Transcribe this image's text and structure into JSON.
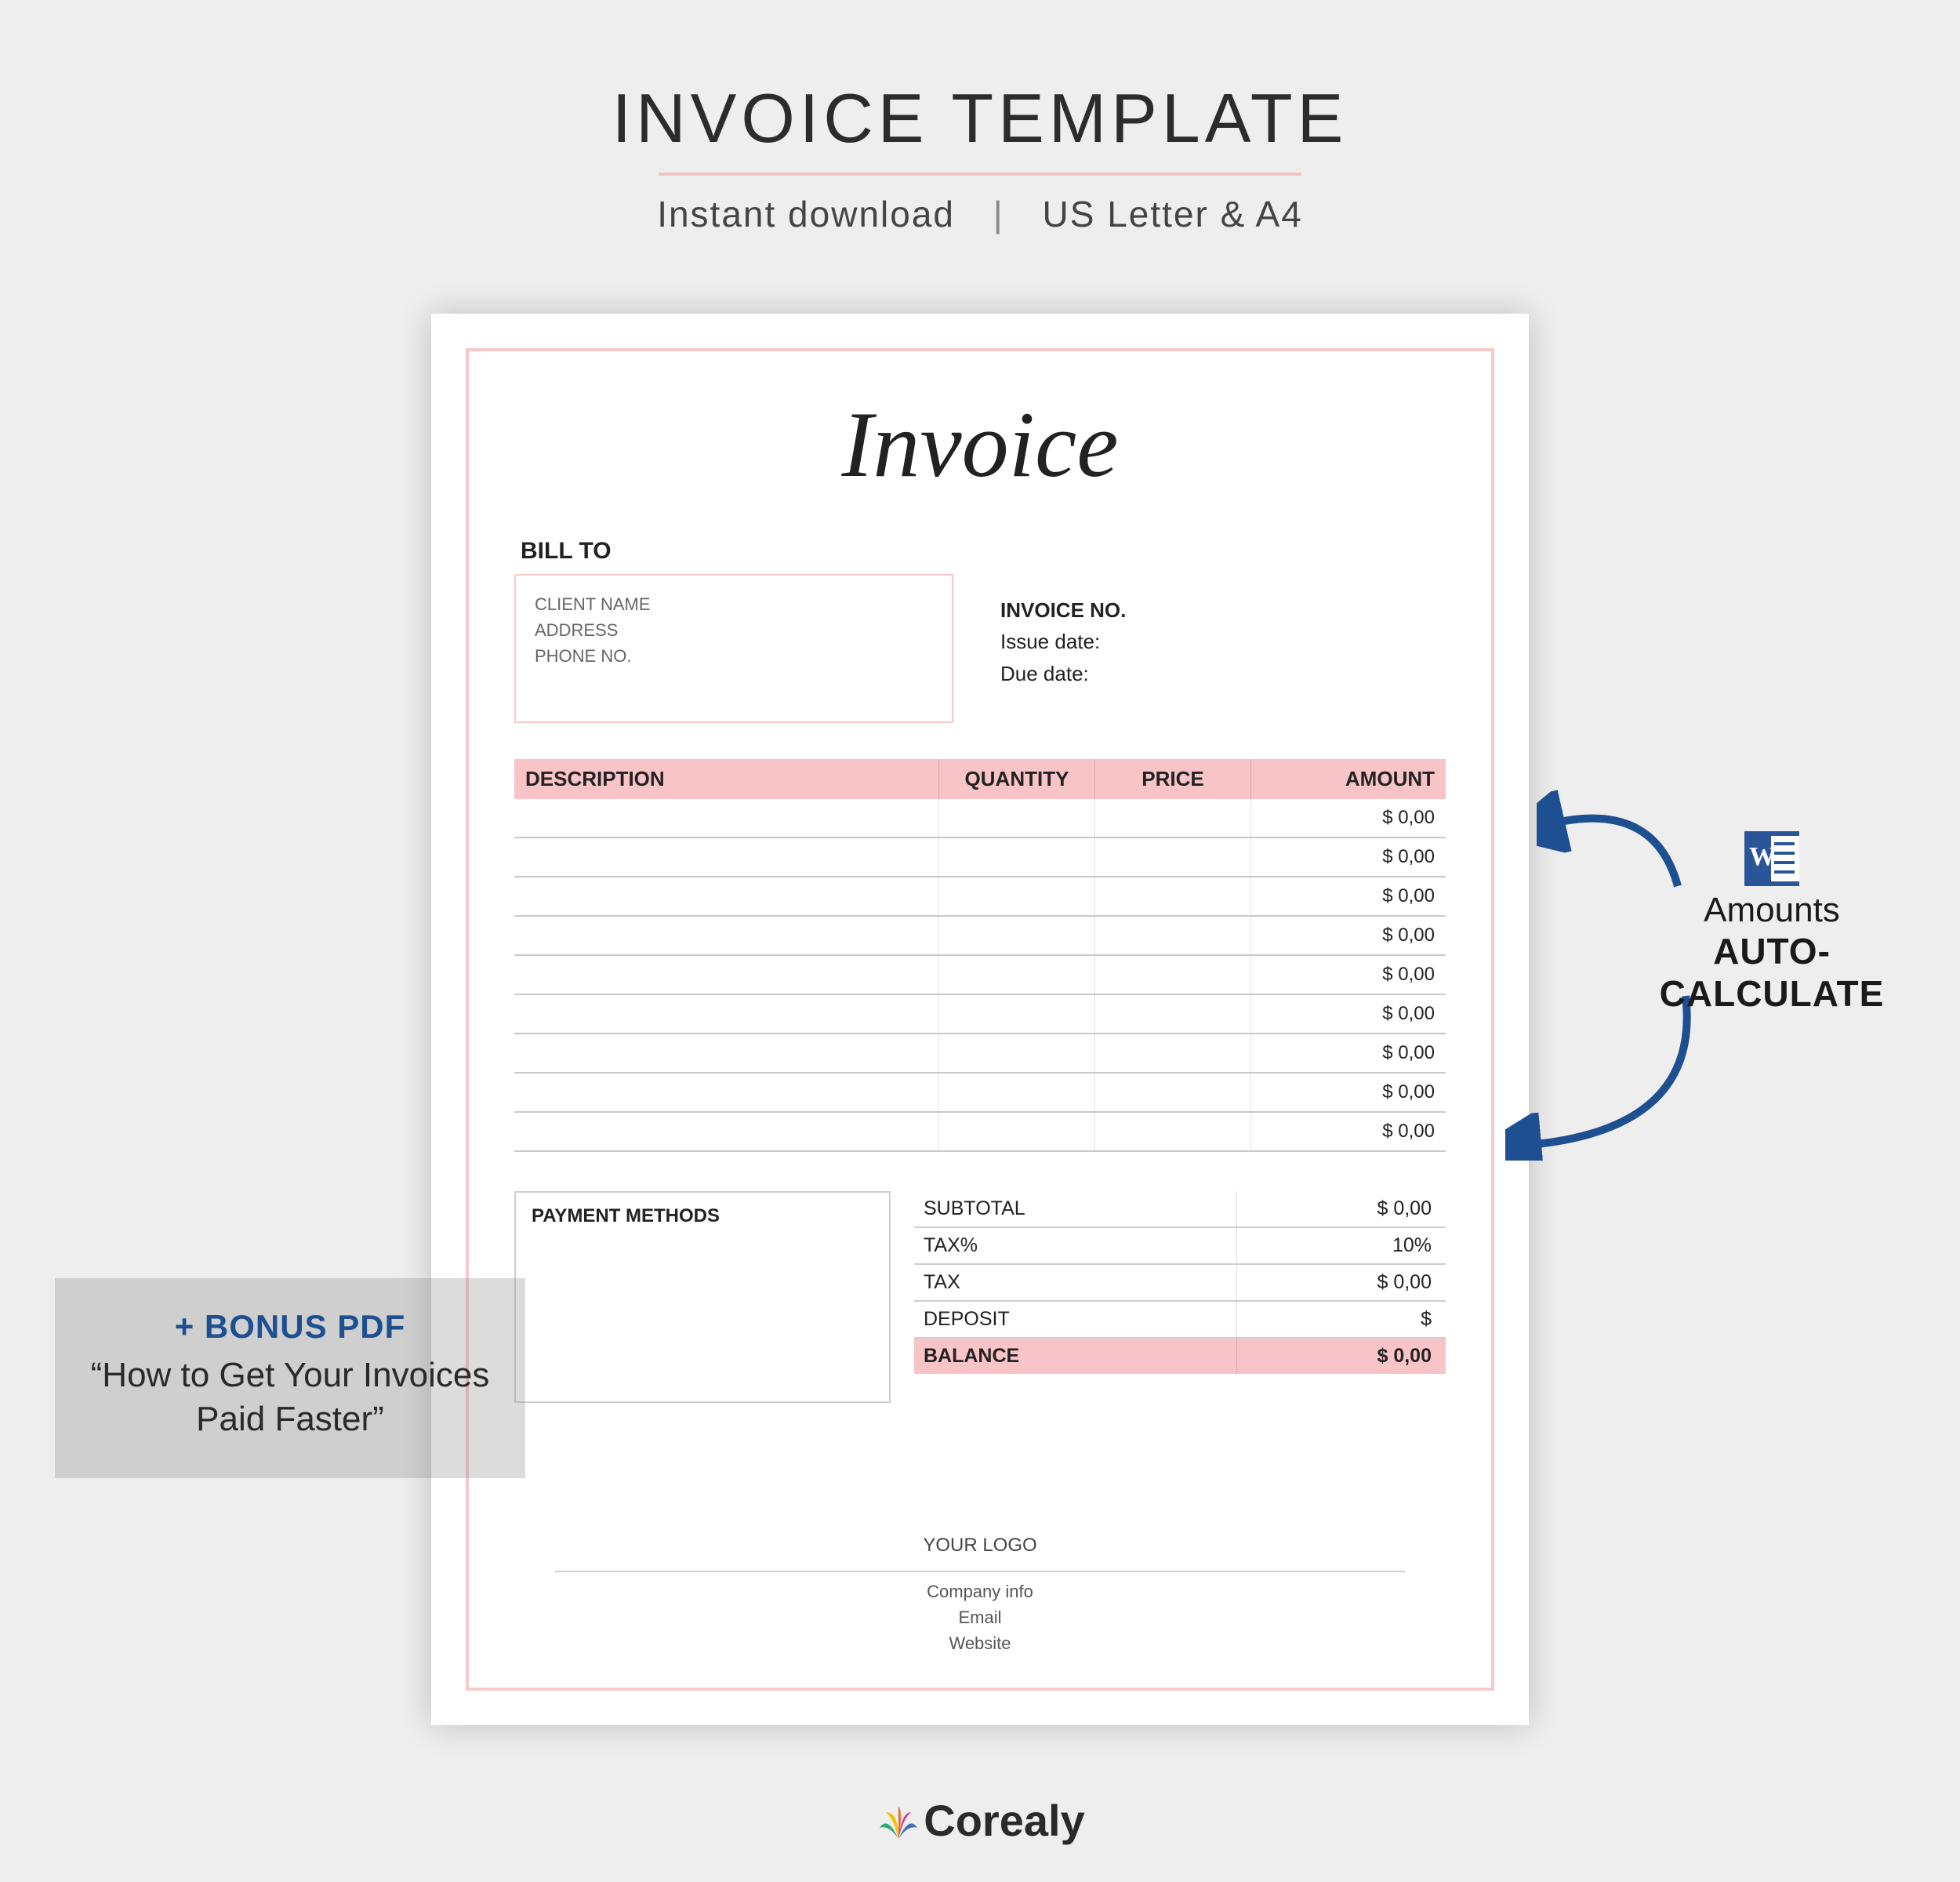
{
  "header": {
    "title": "INVOICE TEMPLATE",
    "sub_left": "Instant download",
    "sub_right": "US Letter & A4"
  },
  "doc": {
    "title": "Invoice",
    "bill_to_label": "BILL TO",
    "client": {
      "name": "CLIENT NAME",
      "address": "ADDRESS",
      "phone": "PHONE NO."
    },
    "meta": {
      "no_label": "INVOICE NO.",
      "issue": "Issue date:",
      "due": "Due date:"
    },
    "cols": {
      "desc": "DESCRIPTION",
      "qty": "QUANTITY",
      "price": "PRICE",
      "amt": "AMOUNT"
    },
    "rows": [
      {
        "amount": "$  0,00"
      },
      {
        "amount": "$  0,00"
      },
      {
        "amount": "$  0,00"
      },
      {
        "amount": "$  0,00"
      },
      {
        "amount": "$  0,00"
      },
      {
        "amount": "$  0,00"
      },
      {
        "amount": "$  0,00"
      },
      {
        "amount": "$  0,00"
      },
      {
        "amount": "$  0,00"
      }
    ],
    "payment_label": "PAYMENT METHODS",
    "totals": {
      "subtotal_l": "SUBTOTAL",
      "subtotal_v": "$   0,00",
      "taxpct_l": "TAX%",
      "taxpct_v": "10%",
      "tax_l": "TAX",
      "tax_v": "$   0,00",
      "deposit_l": "DEPOSIT",
      "deposit_v": "$",
      "balance_l": "BALANCE",
      "balance_v": "$   0,00"
    },
    "footer": {
      "logo": "YOUR LOGO",
      "company": "Company info",
      "email": "Email",
      "website": "Website"
    }
  },
  "auto": {
    "l1": "Amounts",
    "l2": "AUTO-CALCULATE"
  },
  "bonus": {
    "t1": "+ BONUS PDF",
    "t2": "“How to Get Your Invoices Paid Faster”"
  },
  "brand": "Corealy"
}
